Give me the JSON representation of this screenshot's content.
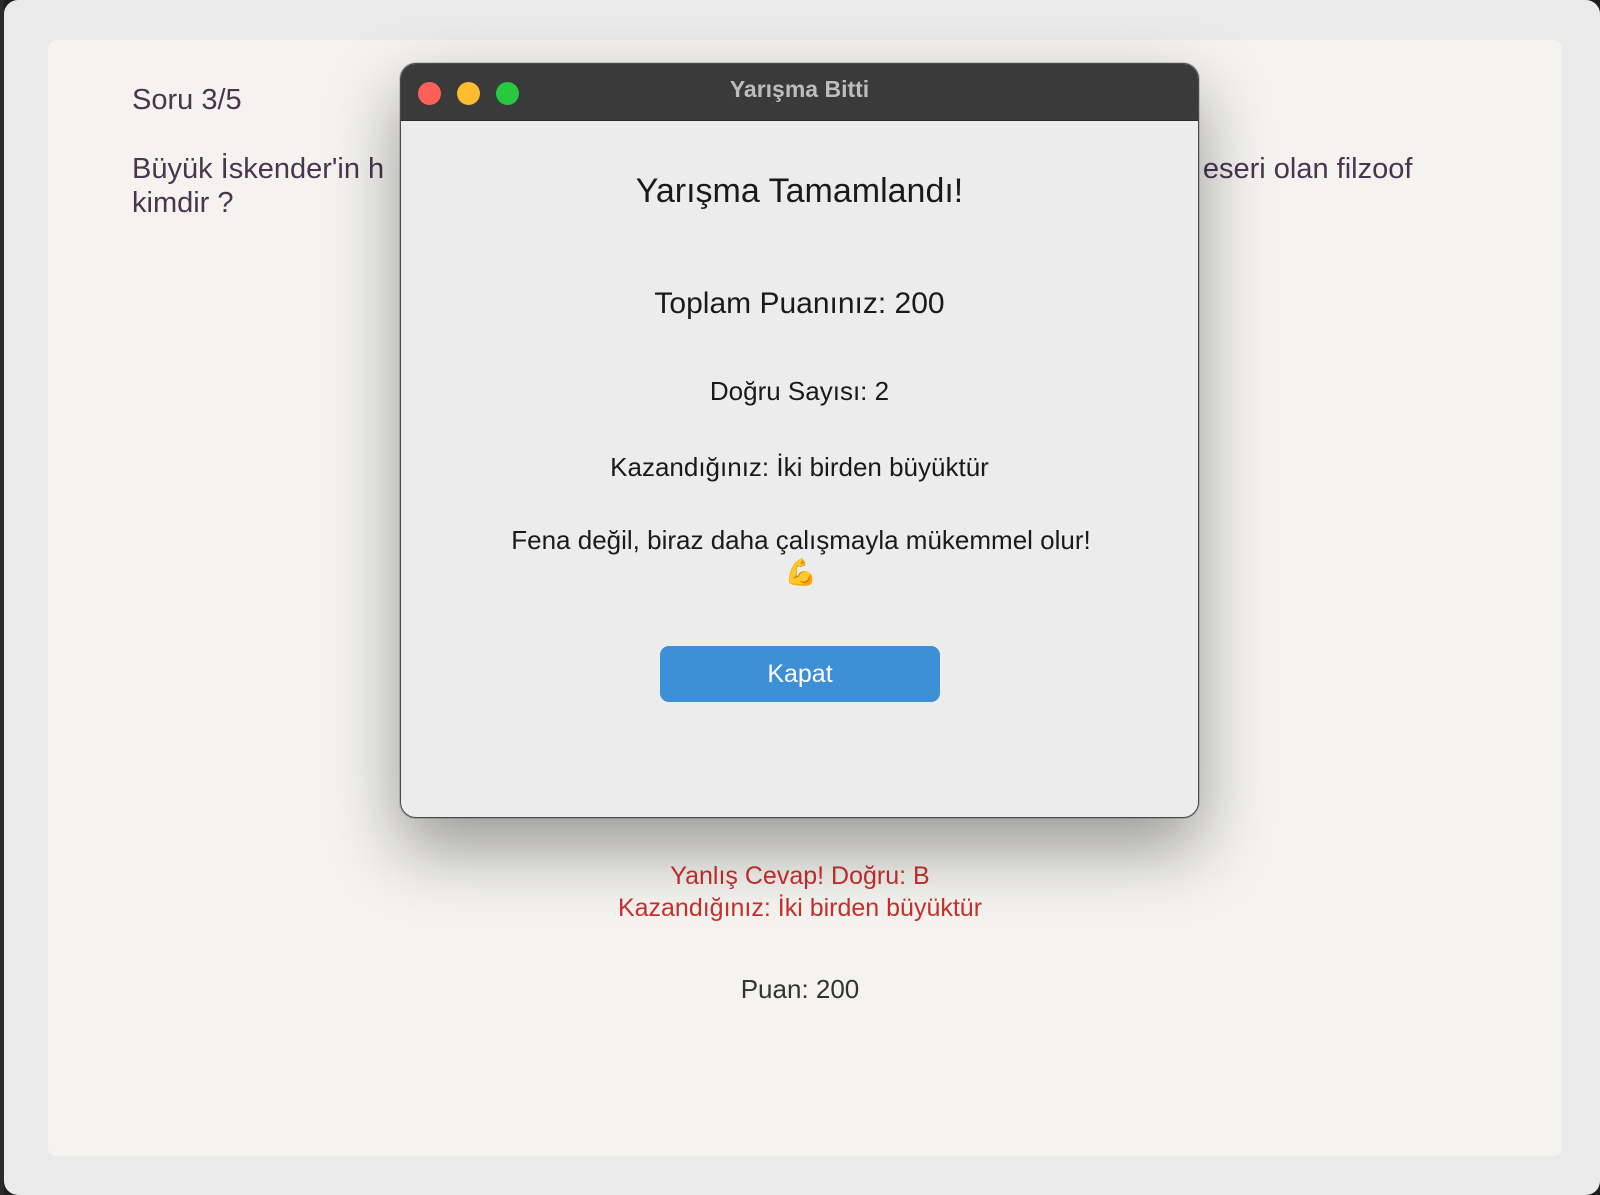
{
  "quiz": {
    "question_counter": "Soru 3/5",
    "question_text": "Büyük İskender'in h",
    "question_text_right": "dlı eseri olan filzoof",
    "question_text_line2": "kimdir ?",
    "feedback_line1": "Yanlış Cevap! Doğru: B",
    "feedback_line2": "Kazandığınız: İki birden büyüktür",
    "score": "Puan: 200",
    "feedback_color": "#c9302c"
  },
  "dialog": {
    "window_title": "Yarışma Bitti",
    "heading": "Yarışma Tamamlandı!",
    "total_score": "Toplam Puanınız: 200",
    "correct_count": "Doğru Sayısı: 2",
    "prize": "Kazandığınız: İki birden büyüktür",
    "message": "Fena değil, biraz daha çalışmayla mükemmel olur! 💪",
    "close_button": "Kapat",
    "button_color": "#3d8fd6",
    "traffic_lights": [
      "close-icon",
      "minimize-icon",
      "maximize-icon"
    ]
  }
}
